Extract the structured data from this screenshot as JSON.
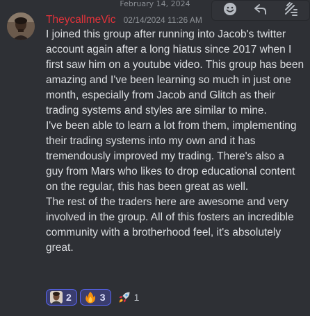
{
  "date_divider": "February 14, 2024",
  "message": {
    "username": "TheycallmeVic",
    "timestamp": "02/14/2024 11:26 AM",
    "avatar_icon": "user-avatar",
    "username_color": "#e3323a",
    "paragraphs": [
      "I joined this group after running into Jacob's twitter account again after a long hiatus since 2017 when I first saw him on a youtube video. This group has been amazing and I've been learning so much in just one month, especially from Jacob and Glitch as their trading systems and styles are similar to mine.",
      "I've been able to learn a lot from them, implementing their trading systems into my own and it has tremendously improved my trading. There's also a guy from Mars who likes to drop educational content on the regular, this has been great as well.",
      "The rest of the traders here are awesome and very involved in the group. All of this fosters an incredible community with a brotherhood feel, it's absolutely great."
    ]
  },
  "toolbar": {
    "buttons": [
      {
        "icon": "add-reaction-icon"
      },
      {
        "icon": "reply-icon"
      },
      {
        "icon": "thread-icon"
      }
    ]
  },
  "reactions": [
    {
      "emoji": "custom-face-emoji",
      "count": "2",
      "active": true
    },
    {
      "emoji": "fire-emoji",
      "count": "3",
      "active": true
    },
    {
      "emoji": "rocket-emoji",
      "count": "1",
      "active": false
    }
  ],
  "accent_color": "#5865f2"
}
